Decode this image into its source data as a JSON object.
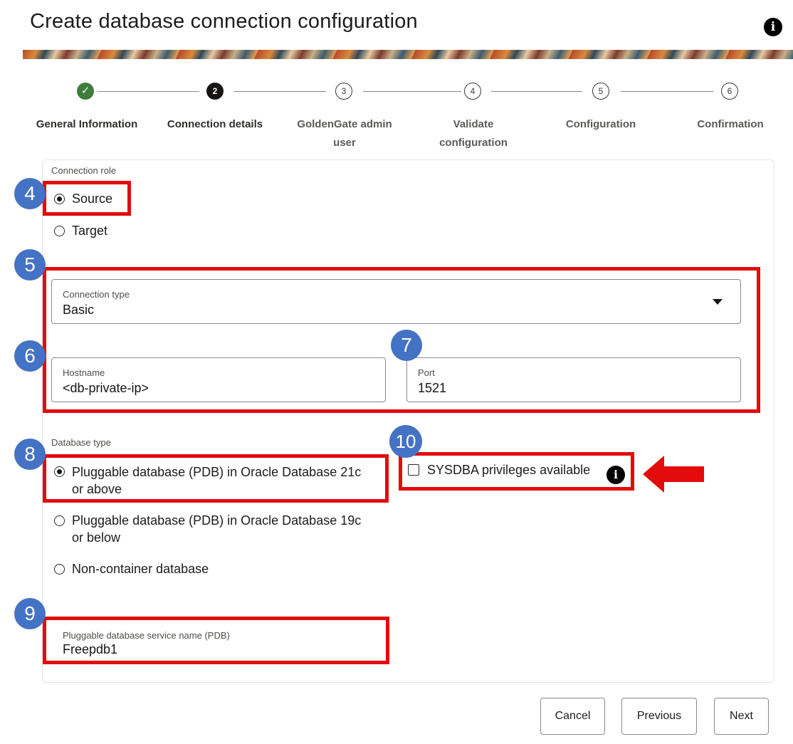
{
  "header": {
    "title": "Create database connection configuration"
  },
  "steps": [
    {
      "label": "General Information",
      "state": "done"
    },
    {
      "label": "Connection details",
      "number": "2",
      "state": "current"
    },
    {
      "label": "GoldenGate admin user",
      "number": "3",
      "state": "todo"
    },
    {
      "label": "Validate configuration",
      "number": "4",
      "state": "todo"
    },
    {
      "label": "Configuration",
      "number": "5",
      "state": "todo"
    },
    {
      "label": "Confirmation",
      "number": "6",
      "state": "todo"
    }
  ],
  "connection_role": {
    "label": "Connection role",
    "options": [
      "Source",
      "Target"
    ],
    "selected": "Source"
  },
  "connection_type": {
    "label": "Connection type",
    "value": "Basic"
  },
  "hostname": {
    "label": "Hostname",
    "value": "<db-private-ip>"
  },
  "port": {
    "label": "Port",
    "value": "1521"
  },
  "database_type": {
    "label": "Database type",
    "options": [
      {
        "line1": "Pluggable database (PDB) in Oracle Database 21c",
        "line2": "or above"
      },
      {
        "line1": "Pluggable database (PDB) in Oracle Database 19c",
        "line2": "or below"
      },
      {
        "line1": "Non-container database",
        "line2": ""
      }
    ],
    "selected_index": 0
  },
  "sysdba": {
    "label": "SYSDBA privileges available",
    "checked": false
  },
  "pdb_service": {
    "label": "Pluggable database service name (PDB)",
    "value": "Freepdb1"
  },
  "buttons": {
    "cancel": "Cancel",
    "previous": "Previous",
    "next": "Next"
  },
  "annotations": {
    "b4": "4",
    "b5": "5",
    "b6": "6",
    "b7": "7",
    "b8": "8",
    "b9": "9",
    "b10": "10"
  },
  "colors": {
    "highlight": "#e30b0b",
    "badge": "#4472c4",
    "done": "#3e7d3a"
  }
}
